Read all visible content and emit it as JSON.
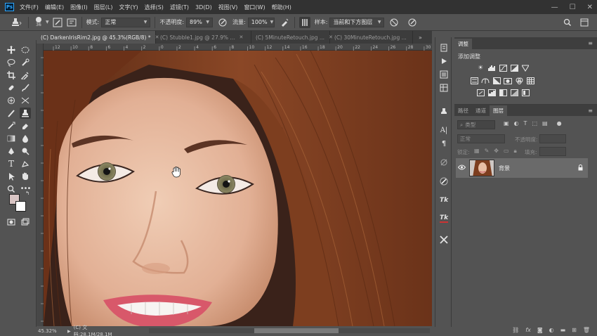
{
  "app": {
    "logo_text": "Ps"
  },
  "menu": [
    "文件(F)",
    "编辑(E)",
    "图像(I)",
    "图层(L)",
    "文字(Y)",
    "选择(S)",
    "滤镜(T)",
    "3D(D)",
    "视图(V)",
    "窗口(W)",
    "帮助(H)"
  ],
  "window_controls": {
    "minimize": "—",
    "maximize": "☐",
    "close": "✕"
  },
  "options_bar": {
    "brush_size": "36",
    "mode_value": "正常",
    "opacity_label": "不透明度:",
    "opacity_value": "89%",
    "flow_label": "流量:",
    "flow_value": "100%",
    "sample_value": "当前和下方图层"
  },
  "doc_tabs": [
    {
      "label": "(C) DarkenIrisRim2.jpg @ 45.3%(RGB/8) *",
      "active": true
    },
    {
      "label": "(C) Stubble1.jpg @ 27.9% ...",
      "active": false
    },
    {
      "label": "(C) 5MinuteRetouch.jpg ...",
      "active": false
    },
    {
      "label": "(C) 30MinuteRetouch.jpg ...",
      "active": false
    }
  ],
  "ruler_ticks": [
    "12",
    "10",
    "8",
    "6",
    "4",
    "2",
    "0",
    "2",
    "4",
    "6",
    "8",
    "10",
    "12",
    "14",
    "16",
    "18",
    "20",
    "22",
    "24",
    "26",
    "28",
    "30"
  ],
  "status": {
    "zoom": "45.32%",
    "doc_size": "(C) 文档:28.1M/28.1M"
  },
  "adjustments_panel": {
    "tab_label": "调整",
    "title": "添加调整"
  },
  "layers_panel": {
    "tabs": [
      "路径",
      "通道",
      "图层"
    ],
    "filter_placeholder": "类型",
    "blend_mode": "正常",
    "opacity_label": "不透明度:",
    "lock_label": "锁定:",
    "fill_label": "填充:",
    "layers": [
      {
        "name": "背景",
        "visible": true,
        "locked": true
      }
    ],
    "footer_icons": [
      "link-icon",
      "fx-icon",
      "mask-icon",
      "adjustment-icon",
      "group-icon",
      "new-layer-icon",
      "delete-icon"
    ]
  },
  "colors": {
    "foreground": "#d9c5c4",
    "background": "#ffffff",
    "ui_dark": "#323232",
    "ui_mid": "#535353"
  }
}
